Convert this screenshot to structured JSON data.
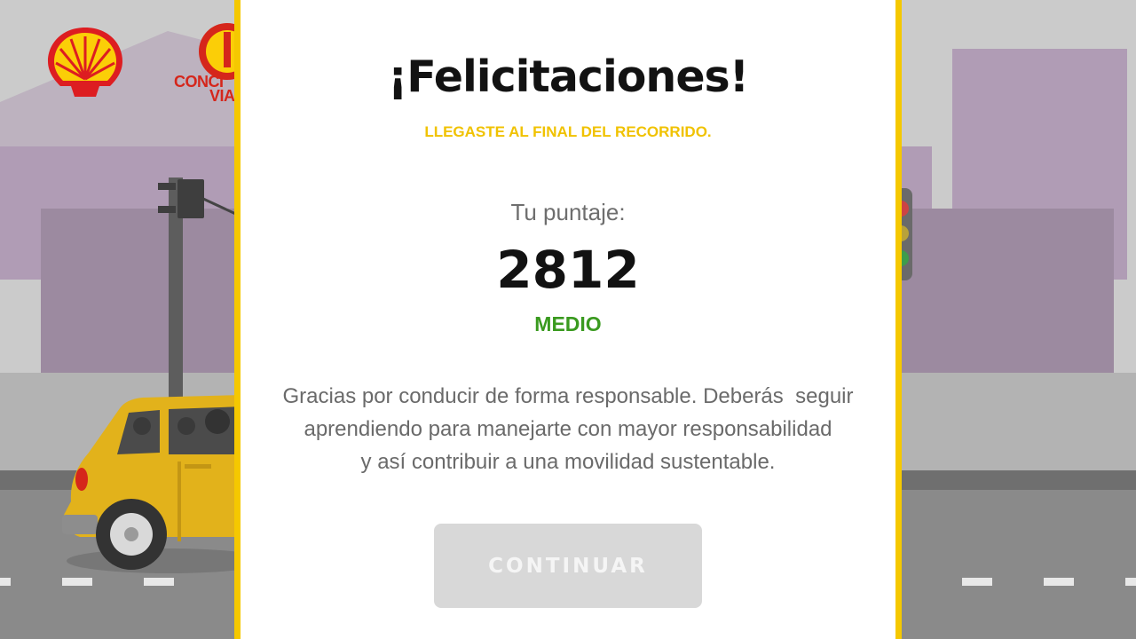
{
  "modal": {
    "title": "¡Felicitaciones!",
    "subtitle": "LLEGASTE AL FINAL DEL RECORRIDO.",
    "score_label": "Tu puntaje:",
    "score_value": "2812",
    "score_level": "MEDIO",
    "message_lines": [
      "Gracias por conducir de forma responsable. Deberás  seguir",
      "aprendiendo para manejarte con mayor responsabilidad",
      "y así contribuir a una movilidad sustentable."
    ],
    "continue_label": "CONTINUAR"
  },
  "branding": {
    "badge_text_line1": "CONCI",
    "badge_text_line2": "VIA"
  },
  "colors": {
    "accent_yellow": "#f5c800",
    "level_green": "#3a9a1f",
    "button_disabled": "#d8d8d8"
  },
  "icons": {
    "shell_logo": "shell-logo-icon",
    "badge_logo": "conciencia-vial-badge-icon"
  }
}
